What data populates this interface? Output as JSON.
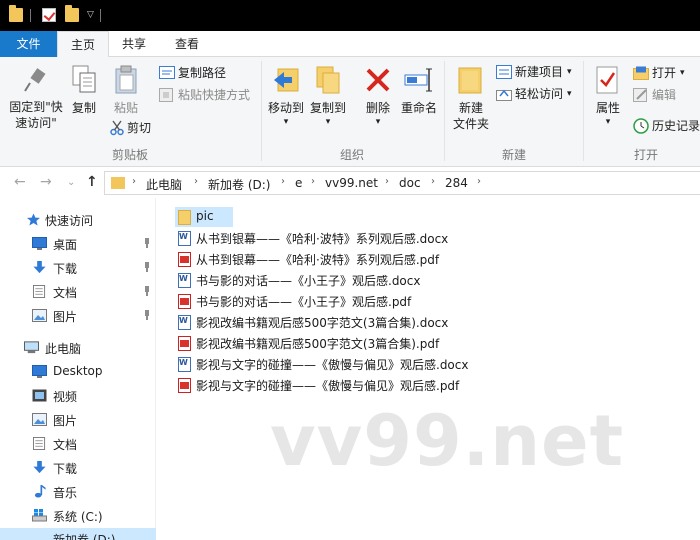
{
  "ribbon_tabs": {
    "file": "文件",
    "home": "主页",
    "share": "共享",
    "view": "查看"
  },
  "clipboard": {
    "pin_label_1": "固定到\"快",
    "pin_label_2": "速访问\"",
    "copy": "复制",
    "paste": "粘贴",
    "copy_path": "复制路径",
    "paste_shortcut": "粘贴快捷方式",
    "cut": "剪切",
    "group": "剪贴板"
  },
  "organize": {
    "move_to": "移动到",
    "copy_to": "复制到",
    "delete": "删除",
    "rename": "重命名",
    "group": "组织"
  },
  "new_group": {
    "new_folder_1": "新建",
    "new_folder_2": "文件夹",
    "new_item": "新建项目",
    "easy_access": "轻松访问",
    "group": "新建"
  },
  "open_group": {
    "properties": "属性",
    "open": "打开",
    "edit": "编辑",
    "history": "历史记录",
    "group": "打开"
  },
  "address": {
    "crumbs": [
      "此电脑",
      "新加卷 (D:)",
      "e",
      "vv99.net",
      "doc",
      "284"
    ]
  },
  "sidebar": {
    "items": [
      {
        "label": "快速访问"
      },
      {
        "label": "桌面"
      },
      {
        "label": "下载"
      },
      {
        "label": "文档"
      },
      {
        "label": "图片"
      },
      {
        "label": "此电脑"
      },
      {
        "label": "Desktop"
      },
      {
        "label": "视频"
      },
      {
        "label": "图片"
      },
      {
        "label": "文档"
      },
      {
        "label": "下载"
      },
      {
        "label": "音乐"
      },
      {
        "label": "系统 (C:)"
      },
      {
        "label": "新加卷 (D:)"
      }
    ]
  },
  "files": [
    {
      "name": "pic",
      "type": "folder"
    },
    {
      "name": "从书到银幕——《哈利·波特》系列观后感.docx",
      "type": "docx"
    },
    {
      "name": "从书到银幕——《哈利·波特》系列观后感.pdf",
      "type": "pdf"
    },
    {
      "name": "书与影的对话——《小王子》观后感.docx",
      "type": "docx"
    },
    {
      "name": "书与影的对话——《小王子》观后感.pdf",
      "type": "pdf"
    },
    {
      "name": "影视改编书籍观后感500字范文(3篇合集).docx",
      "type": "docx"
    },
    {
      "name": "影视改编书籍观后感500字范文(3篇合集).pdf",
      "type": "pdf"
    },
    {
      "name": "影视与文字的碰撞——《傲慢与偏见》观后感.docx",
      "type": "docx"
    },
    {
      "name": "影视与文字的碰撞——《傲慢与偏见》观后感.pdf",
      "type": "pdf"
    }
  ],
  "watermark": "vv99.net",
  "colors": {
    "accent": "#1979ca",
    "selection": "#cce8ff",
    "folder": "#f2c65a"
  }
}
